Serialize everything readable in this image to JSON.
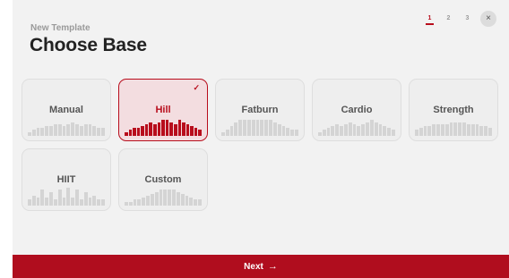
{
  "header": {
    "subtitle": "New Template",
    "title": "Choose Base"
  },
  "steps": [
    {
      "label": "1",
      "active": true
    },
    {
      "label": "2",
      "active": false
    },
    {
      "label": "3",
      "active": false
    }
  ],
  "close_icon": "×",
  "check_icon": "✓",
  "cards": [
    {
      "id": "manual",
      "label": "Manual",
      "selected": false,
      "profile": [
        2,
        3,
        4,
        4,
        5,
        5,
        6,
        6,
        5,
        6,
        7,
        6,
        5,
        6,
        6,
        5,
        4,
        4
      ]
    },
    {
      "id": "hill",
      "label": "Hill",
      "selected": true,
      "profile": [
        2,
        3,
        4,
        4,
        5,
        6,
        7,
        6,
        7,
        8,
        8,
        7,
        6,
        8,
        7,
        6,
        5,
        4,
        3
      ]
    },
    {
      "id": "fatburn",
      "label": "Fatburn",
      "selected": false,
      "profile": [
        2,
        3,
        5,
        7,
        8,
        8,
        8,
        8,
        8,
        8,
        8,
        8,
        7,
        6,
        5,
        4,
        3,
        3
      ]
    },
    {
      "id": "cardio",
      "label": "Cardio",
      "selected": false,
      "profile": [
        2,
        3,
        4,
        5,
        6,
        5,
        6,
        7,
        6,
        5,
        6,
        7,
        8,
        7,
        6,
        5,
        4,
        3
      ]
    },
    {
      "id": "strength",
      "label": "Strength",
      "selected": false,
      "profile": [
        3,
        4,
        5,
        5,
        6,
        6,
        6,
        6,
        7,
        7,
        7,
        7,
        6,
        6,
        6,
        5,
        5,
        4
      ]
    },
    {
      "id": "hiit",
      "label": "HIIT",
      "selected": false,
      "profile": [
        3,
        5,
        4,
        8,
        4,
        7,
        3,
        8,
        4,
        9,
        4,
        8,
        3,
        7,
        4,
        5,
        3,
        3
      ]
    },
    {
      "id": "custom",
      "label": "Custom",
      "selected": false,
      "profile": [
        2,
        2,
        3,
        3,
        4,
        5,
        6,
        7,
        8,
        8,
        8,
        8,
        7,
        6,
        5,
        4,
        3,
        3
      ]
    }
  ],
  "footer": {
    "next_label": "Next",
    "next_arrow": "→"
  },
  "colors": {
    "accent": "#b80d1c",
    "bar": "#d4d4d4"
  }
}
